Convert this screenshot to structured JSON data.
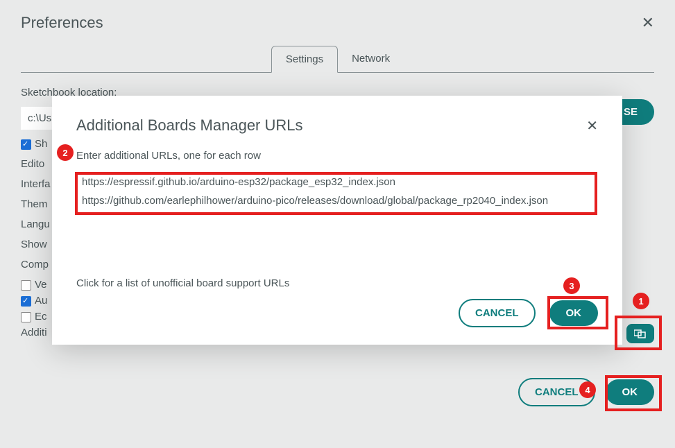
{
  "prefs": {
    "title": "Preferences",
    "tabs": {
      "settings": "Settings",
      "network": "Network"
    },
    "labels": {
      "sketchbook": "Sketchbook location:",
      "path": "c:\\Us",
      "showSketches": "Sh",
      "editor": "Edito",
      "interface": "Interfa",
      "theme": "Them",
      "language": "Langu",
      "show": "Show",
      "compiler": "Comp",
      "verify": "Ve",
      "auto": "Au",
      "export": "Ec",
      "additional": "Additi"
    },
    "buttons": {
      "browse": "SE",
      "cancel": "CANCEL",
      "ok": "OK"
    }
  },
  "modal": {
    "title": "Additional Boards Manager URLs",
    "instruction": "Enter additional URLs, one for each row",
    "urls": "https://espressif.github.io/arduino-esp32/package_esp32_index.json\nhttps://github.com/earlephilhower/arduino-pico/releases/download/global/package_rp2040_index.json",
    "footer": "Click for a list of unofficial board support URLs",
    "cancel": "CANCEL",
    "ok": "OK"
  },
  "markers": {
    "m1": "1",
    "m2": "2",
    "m3": "3",
    "m4": "4"
  }
}
